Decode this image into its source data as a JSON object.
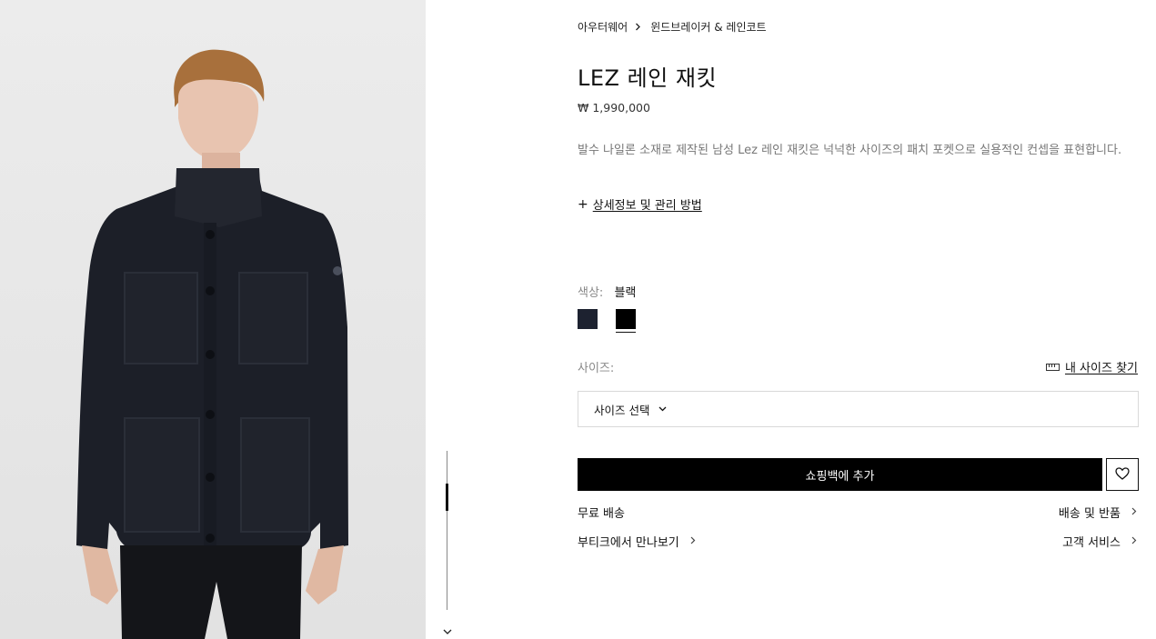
{
  "breadcrumb": {
    "items": [
      "아우터웨어",
      "윈드브레이커 & 레인코트"
    ],
    "separator": "›"
  },
  "product": {
    "title": "LEZ 레인 재킷",
    "price": "₩ 1,990,000",
    "description": "발수 나일론 소재로 제작된 남성 Lez 레인 재킷은 넉넉한 사이즈의 패치 포켓으로 실용적인 컨셉을 표현합니다.",
    "details_toggle": "상세정보 및 관리 방법",
    "details_plus": "+"
  },
  "color": {
    "label": "색상:",
    "selected": "블랙",
    "swatches": [
      {
        "name": "navy",
        "hex": "#1d2230"
      },
      {
        "name": "black",
        "hex": "#000000",
        "selected": true
      }
    ]
  },
  "size": {
    "label": "사이즈:",
    "guide": "내 사이즈 찾기",
    "select_placeholder": "사이즈 선택"
  },
  "actions": {
    "add_to_bag": "쇼핑백에 추가"
  },
  "info": {
    "free_shipping": "무료 배송",
    "shipping_returns": "배송 및 반품",
    "boutique": "부티크에서 만나보기",
    "customer_service": "고객 서비스"
  },
  "icons": {
    "breadcrumb_sep": "chevron-right-icon",
    "dropdown": "chevron-down-icon",
    "wishlist": "heart-icon",
    "size_guide": "ruler-icon",
    "gallery_next": "chevron-down-icon"
  },
  "colors": {
    "accent": "#000000",
    "muted_text": "#777777",
    "border": "#d9d9d9"
  }
}
